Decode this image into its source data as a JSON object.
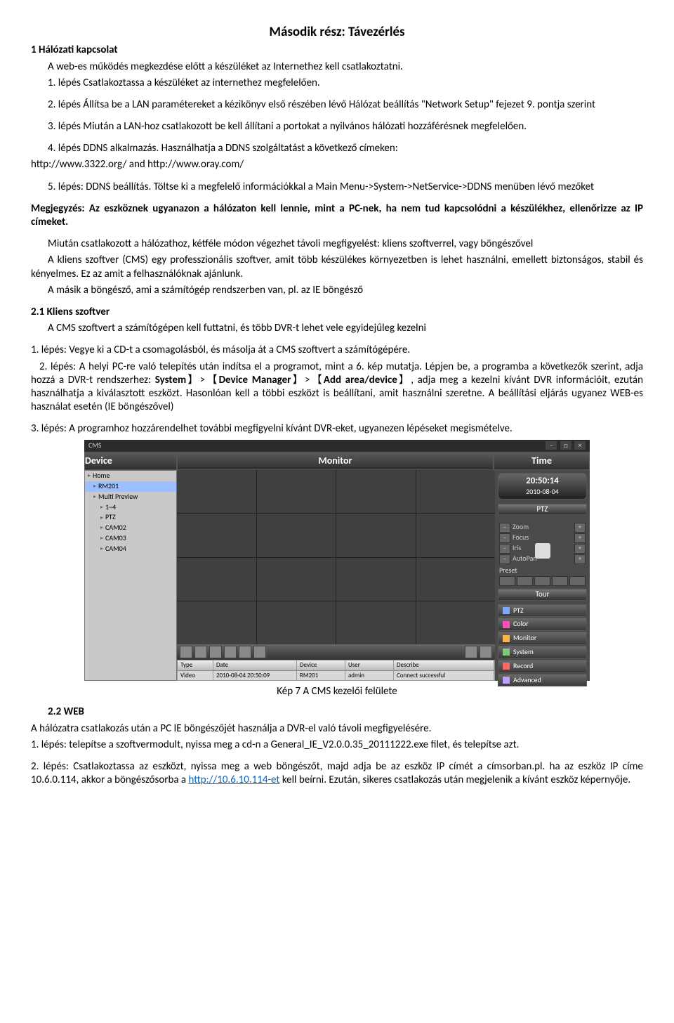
{
  "title": "Második rész: Távezérlés",
  "s1_head": "1 Hálózati kapcsolat",
  "s1_intro": "A web-es működés megkezdése előtt a készüléket az Internethez kell csatlakoztatni.",
  "step1": "1. lépés Csatlakoztassa a készüléket az internethez megfelelően.",
  "step2": "2. lépés Állítsa be a LAN paramétereket a kézikönyv első részében lévő Hálózat beállítás \"Network Setup\" fejezet 9. pontja szerint",
  "step3": "3. lépés Miután a LAN-hoz csatlakozott be kell állítani a portokat a nyilvános hálózati hozzáférésnek megfelelően.",
  "step4a": "4.    lépés    DDNS    alkalmazás.    Használhatja    a    DDNS    szolgáltatást    a    következő    címeken:",
  "step4b": "http://www.3322.org/ and http://www.oray.com/",
  "step5": "5.    lépés: DDNS beállítás. Töltse ki a megfelelő információkkal a Main Menu->System->NetService->DDNS menüben lévő mezőket",
  "note": "Megjegyzés: Az eszköznek ugyanazon a hálózaton kell lennie, mint a PC-nek, ha nem tud kapcsolódni a készülékhez, ellenőrizze az IP címeket.",
  "after1": "Miután csatlakozott a hálózathoz, kétféle módon végezhet távoli megfigyelést: kliens szoftverrel, vagy böngészővel",
  "after2": "A kliens  szoftver (CMS) egy professzionális szoftver, amit több készülékes környezetben is lehet használni, emellett  biztonságos, stabil és kényelmes. Ez az amit a felhasználóknak ajánlunk.",
  "after3": "A másik a böngésző, ami a számítógép rendszerben van, pl. az IE böngésző",
  "s21_head": "2.1 Kliens szoftver",
  "s21_1": "A CMS szoftvert a számítógépen kell futtatni, és több DVR-t lehet vele egyidejűleg kezelni",
  "s21_step1": "1.   lépés: Vegye ki a CD-t a csomagolásból, és másolja át a CMS szoftvert a számítógépére.",
  "s21_step2a": "2. lépés: A helyi PC-re való telepítés után indítsa el a programot, mint a 6. kép mutatja.   Lépjen be, a programba a következők szerint, adja hozzá a DVR-t  rendszerhez:  ",
  "s21_step2b": "System",
  "s21_step2c": "】>【",
  "s21_step2d": "Device Manager",
  "s21_step2e": "】>【",
  "s21_step2f": "Add area/device",
  "s21_step2g": "】, adja meg a kezelni kívánt DVR információit, ezután használhatja a kiválasztott eszközt. Hasonlóan kell a többi eszközt is beállítani, amit használni szeretne. A beállítási eljárás ugyanez WEB-es használat esetén (IE böngészővel)",
  "s21_step3": "3. lépés: A programhoz hozzárendelhet további megfigyelni kívánt DVR-eket, ugyanezen lépéseket megismételve.",
  "caption": "Kép 7  A CMS kezelői felülete",
  "s22_head": "2.2  WEB",
  "s22_1": "A hálózatra csatlakozás után a PC IE böngészőjét használja a DVR-el való távoli megfigyelésére.",
  "s22_2": "1. lépés: telepítse a szoftvermodult, nyissa meg a cd-n a General_IE_V2.0.0.35_20111222.exe filet, és telepítse azt.",
  "s22_3a": "2.   lépés: Csatlakoztassa az eszközt, nyissa meg a web böngészőt, majd adja be az eszköz IP címét a címsorban.pl. ha az eszköz IP címe 10.6.0.114, akkor a böngészősorba a ",
  "s22_3link": "http://10.6.10.114-et",
  "s22_3b": " kell beírni. Ezután, sikeres csatlakozás után megjelenik a kívánt eszköz képernyője.",
  "cms": {
    "app": "CMS",
    "headers": [
      "Device",
      "Monitor",
      "Time"
    ],
    "tree": [
      "Home",
      "RM201",
      "Multi Preview",
      "1~4",
      "PTZ",
      "CAM02",
      "CAM03",
      "CAM04"
    ],
    "grid_cells": 16,
    "clock_time": "20:50:14",
    "clock_date": "2010-08-04",
    "ptz_label": "PTZ",
    "sliders": [
      "Zoom",
      "Focus",
      "Iris",
      "AutoPan"
    ],
    "preset_label": "Preset",
    "tour_label": "Tour",
    "side_panels": [
      {
        "label": "PTZ",
        "color": "#7fa8ff"
      },
      {
        "label": "Color",
        "color": "#ff4fb8"
      },
      {
        "label": "Monitor",
        "color": "#ffb347"
      },
      {
        "label": "System",
        "color": "#7fc97f"
      },
      {
        "label": "Record",
        "color": "#ff6666"
      },
      {
        "label": "Advanced",
        "color": "#bda0ff"
      }
    ],
    "log_headers": [
      "Type",
      "Date",
      "Device",
      "User",
      "Describe"
    ],
    "log_row": [
      "Video",
      "2010-08-04 20:50:09",
      "RM201",
      "admin",
      "Connect successful"
    ]
  }
}
